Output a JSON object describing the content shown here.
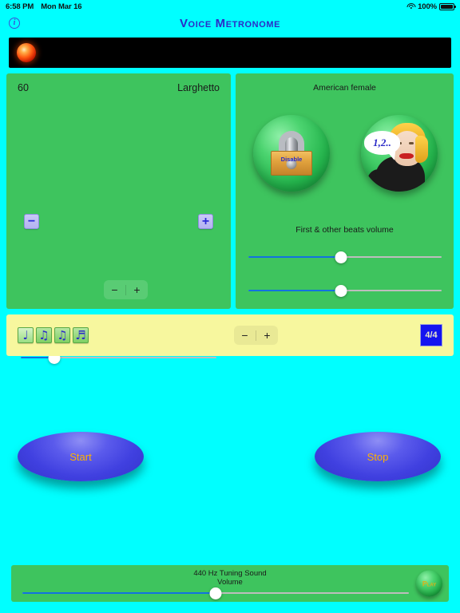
{
  "status_bar": {
    "time": "6:58 PM",
    "date": "Mon Mar 16",
    "battery_percent": "100%",
    "wifi_icon": "wifi-icon",
    "battery_icon": "battery-full-icon"
  },
  "header": {
    "title": "Voice Metronome",
    "info_icon": "info-circle-icon"
  },
  "display": {
    "beat_led_icon": "beat-indicator-led"
  },
  "tempo_panel": {
    "bpm": "60",
    "tempo_name": "Larghetto",
    "decrease_label": "−",
    "increase_label": "+",
    "stepper_minus": "−",
    "stepper_plus": "+",
    "tempo_slider_value": 17
  },
  "voice_panel": {
    "voice_label": "American female",
    "lock_button_text": "Disable",
    "lock_icon": "padlock-icon",
    "voice_button_text": "1,2..",
    "voice_icon": "speaking-woman-icon",
    "beats_volume_label": "First & other beats volume",
    "first_beat_volume": 48,
    "other_beats_volume": 48
  },
  "subdivision_bar": {
    "notes": [
      {
        "glyph": "♩",
        "name": "quarter-note",
        "selected": true
      },
      {
        "glyph": "♫",
        "name": "eighth-notes",
        "selected": false
      },
      {
        "glyph": "♫",
        "name": "triplet-notes",
        "selected": false
      },
      {
        "glyph": "♬",
        "name": "sixteenth-notes",
        "selected": false
      }
    ],
    "stepper_minus": "−",
    "stepper_plus": "+",
    "time_signature": "4/4"
  },
  "transport": {
    "start_label": "Start",
    "stop_label": "Stop"
  },
  "tuning": {
    "line1": "440 Hz Tuning Sound",
    "line2": "Volume",
    "volume_value": 50,
    "play_label": "Play"
  },
  "colors": {
    "background": "#00FFFF",
    "panel_green": "#3EC45E",
    "bar_yellow": "#F7F79E",
    "accent_blue": "#1414F0",
    "slider_fill": "#1272E0",
    "title_blue": "#2B2BC8",
    "button_text_orange": "#FFB300"
  }
}
